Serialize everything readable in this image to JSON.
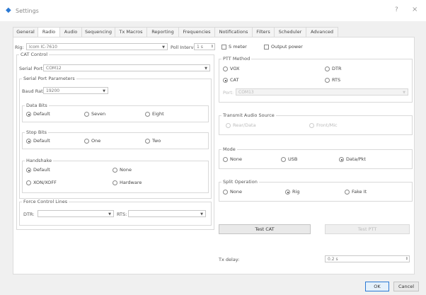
{
  "window": {
    "title": "Settings",
    "help": "?",
    "close": "×"
  },
  "tabs": [
    "General",
    "Radio",
    "Audio",
    "Sequencing",
    "Tx Macros",
    "Reporting",
    "Frequencies",
    "Notifications",
    "Filters",
    "Scheduler",
    "Advanced"
  ],
  "active_tab": "Radio",
  "rig": {
    "label": "Rig:",
    "value": "Icom IC-7610"
  },
  "poll": {
    "label": "Poll Interval:",
    "value": "1 s"
  },
  "smeter_label": "S meter",
  "output_power_label": "Output power",
  "cat": {
    "title": "CAT Control",
    "serial_port_label": "Serial Port:",
    "serial_port_value": "COM12",
    "params_title": "Serial Port Parameters",
    "baud_label": "Baud Rate:",
    "baud_value": "19200",
    "data_bits": {
      "title": "Data Bits",
      "options": [
        "Default",
        "Seven",
        "Eight"
      ],
      "selected": 0
    },
    "stop_bits": {
      "title": "Stop Bits",
      "options": [
        "Default",
        "One",
        "Two"
      ],
      "selected": 0
    },
    "handshake": {
      "title": "Handshake",
      "options": [
        "Default",
        "None",
        "XON/XOFF",
        "Hardware"
      ],
      "selected": 0
    },
    "force_lines": {
      "title": "Force Control Lines",
      "dtr_label": "DTR:",
      "rts_label": "RTS:"
    }
  },
  "ptt": {
    "title": "PTT Method",
    "options": [
      "VOX",
      "DTR",
      "CAT",
      "RTS"
    ],
    "selected": 2,
    "port_label": "Port:",
    "port_value": "COM13"
  },
  "tx_audio": {
    "title": "Transmit Audio Source",
    "options": [
      "Rear/Data",
      "Front/Mic"
    ]
  },
  "mode": {
    "title": "Mode",
    "options": [
      "None",
      "USB",
      "Data/Pkt"
    ],
    "selected": 2
  },
  "split": {
    "title": "Split Operation",
    "options": [
      "None",
      "Rig",
      "Fake It"
    ],
    "selected": 1
  },
  "buttons": {
    "test_cat": "Test CAT",
    "test_ptt": "Test PTT",
    "ok": "OK",
    "cancel": "Cancel"
  },
  "tx_delay": {
    "label": "Tx delay:",
    "value": "0.2 s"
  },
  "colors": {
    "accent": "#2b79d4"
  }
}
